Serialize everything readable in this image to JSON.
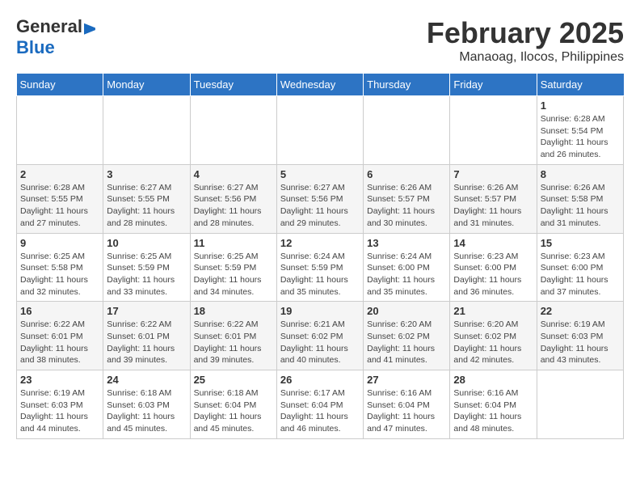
{
  "header": {
    "logo_general": "General",
    "logo_blue": "Blue",
    "month_title": "February 2025",
    "location": "Manaoag, Ilocos, Philippines"
  },
  "days_of_week": [
    "Sunday",
    "Monday",
    "Tuesday",
    "Wednesday",
    "Thursday",
    "Friday",
    "Saturday"
  ],
  "weeks": [
    [
      {
        "day": null
      },
      {
        "day": null
      },
      {
        "day": null
      },
      {
        "day": null
      },
      {
        "day": null
      },
      {
        "day": null
      },
      {
        "day": "1",
        "sunrise": "6:28 AM",
        "sunset": "5:54 PM",
        "daylight": "11 hours and 26 minutes."
      }
    ],
    [
      {
        "day": "2",
        "sunrise": "6:28 AM",
        "sunset": "5:55 PM",
        "daylight": "11 hours and 27 minutes."
      },
      {
        "day": "3",
        "sunrise": "6:27 AM",
        "sunset": "5:55 PM",
        "daylight": "11 hours and 28 minutes."
      },
      {
        "day": "4",
        "sunrise": "6:27 AM",
        "sunset": "5:56 PM",
        "daylight": "11 hours and 28 minutes."
      },
      {
        "day": "5",
        "sunrise": "6:27 AM",
        "sunset": "5:56 PM",
        "daylight": "11 hours and 29 minutes."
      },
      {
        "day": "6",
        "sunrise": "6:26 AM",
        "sunset": "5:57 PM",
        "daylight": "11 hours and 30 minutes."
      },
      {
        "day": "7",
        "sunrise": "6:26 AM",
        "sunset": "5:57 PM",
        "daylight": "11 hours and 31 minutes."
      },
      {
        "day": "8",
        "sunrise": "6:26 AM",
        "sunset": "5:58 PM",
        "daylight": "11 hours and 31 minutes."
      }
    ],
    [
      {
        "day": "9",
        "sunrise": "6:25 AM",
        "sunset": "5:58 PM",
        "daylight": "11 hours and 32 minutes."
      },
      {
        "day": "10",
        "sunrise": "6:25 AM",
        "sunset": "5:59 PM",
        "daylight": "11 hours and 33 minutes."
      },
      {
        "day": "11",
        "sunrise": "6:25 AM",
        "sunset": "5:59 PM",
        "daylight": "11 hours and 34 minutes."
      },
      {
        "day": "12",
        "sunrise": "6:24 AM",
        "sunset": "5:59 PM",
        "daylight": "11 hours and 35 minutes."
      },
      {
        "day": "13",
        "sunrise": "6:24 AM",
        "sunset": "6:00 PM",
        "daylight": "11 hours and 35 minutes."
      },
      {
        "day": "14",
        "sunrise": "6:23 AM",
        "sunset": "6:00 PM",
        "daylight": "11 hours and 36 minutes."
      },
      {
        "day": "15",
        "sunrise": "6:23 AM",
        "sunset": "6:00 PM",
        "daylight": "11 hours and 37 minutes."
      }
    ],
    [
      {
        "day": "16",
        "sunrise": "6:22 AM",
        "sunset": "6:01 PM",
        "daylight": "11 hours and 38 minutes."
      },
      {
        "day": "17",
        "sunrise": "6:22 AM",
        "sunset": "6:01 PM",
        "daylight": "11 hours and 39 minutes."
      },
      {
        "day": "18",
        "sunrise": "6:22 AM",
        "sunset": "6:01 PM",
        "daylight": "11 hours and 39 minutes."
      },
      {
        "day": "19",
        "sunrise": "6:21 AM",
        "sunset": "6:02 PM",
        "daylight": "11 hours and 40 minutes."
      },
      {
        "day": "20",
        "sunrise": "6:20 AM",
        "sunset": "6:02 PM",
        "daylight": "11 hours and 41 minutes."
      },
      {
        "day": "21",
        "sunrise": "6:20 AM",
        "sunset": "6:02 PM",
        "daylight": "11 hours and 42 minutes."
      },
      {
        "day": "22",
        "sunrise": "6:19 AM",
        "sunset": "6:03 PM",
        "daylight": "11 hours and 43 minutes."
      }
    ],
    [
      {
        "day": "23",
        "sunrise": "6:19 AM",
        "sunset": "6:03 PM",
        "daylight": "11 hours and 44 minutes."
      },
      {
        "day": "24",
        "sunrise": "6:18 AM",
        "sunset": "6:03 PM",
        "daylight": "11 hours and 45 minutes."
      },
      {
        "day": "25",
        "sunrise": "6:18 AM",
        "sunset": "6:04 PM",
        "daylight": "11 hours and 45 minutes."
      },
      {
        "day": "26",
        "sunrise": "6:17 AM",
        "sunset": "6:04 PM",
        "daylight": "11 hours and 46 minutes."
      },
      {
        "day": "27",
        "sunrise": "6:16 AM",
        "sunset": "6:04 PM",
        "daylight": "11 hours and 47 minutes."
      },
      {
        "day": "28",
        "sunrise": "6:16 AM",
        "sunset": "6:04 PM",
        "daylight": "11 hours and 48 minutes."
      },
      {
        "day": null
      }
    ]
  ]
}
